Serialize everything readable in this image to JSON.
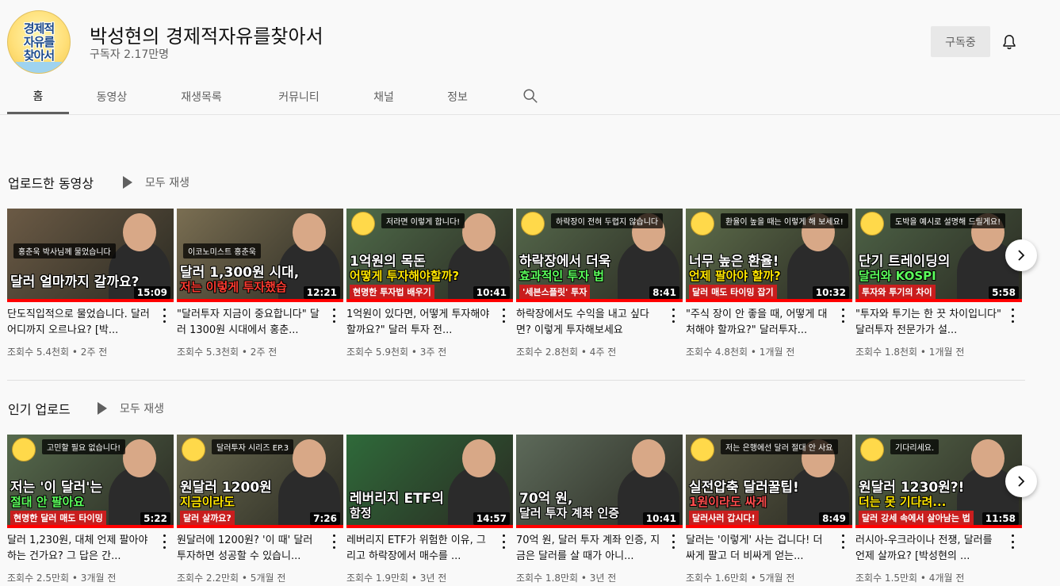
{
  "channel": {
    "avatar_lines": [
      "경제적",
      "자유를",
      "찾아서"
    ],
    "name": "박성현의 경제적자유를찾아서",
    "subscribers": "구독자 2.17만명",
    "subscribed_label": "구독중"
  },
  "tabs": [
    {
      "label": "홈",
      "active": true
    },
    {
      "label": "동영상",
      "active": false
    },
    {
      "label": "재생목록",
      "active": false
    },
    {
      "label": "커뮤니티",
      "active": false
    },
    {
      "label": "채널",
      "active": false
    },
    {
      "label": "정보",
      "active": false
    }
  ],
  "shelves": [
    {
      "title": "업로드한 동영상",
      "play_all": "모두 재생",
      "videos": [
        {
          "title": "단도직입적으로 물었습니다. 달러 어디까지 오르나요? [박...",
          "meta": "조회수 5.4천회 • 2주 전",
          "duration": "15:09",
          "thumb": {
            "strip": "홍춘욱 박사님께 물었습니다",
            "line1": "달러 얼마까지 갈까요?",
            "line2": "",
            "line3": "",
            "accent": "#ffffff",
            "bg": "#6b5a45"
          }
        },
        {
          "title": "\"달러투자 지금이 중요합니다\" 달러 1300원 시대에서 홍춘...",
          "meta": "조회수 5.3천회 • 2주 전",
          "duration": "12:21",
          "thumb": {
            "strip": "이코노미스트 홍춘욱",
            "line1": "달러 1,300원 시대,",
            "line2": "저는 이렇게 투자했습",
            "line3": "",
            "accent": "#ff3b30",
            "bg": "#7a6e52"
          }
        },
        {
          "title": "1억원이 있다면, 어떻게 투자해야 할까요?\" 달러 투자 전...",
          "meta": "조회수 5.9천회 • 3주 전",
          "duration": "10:41",
          "thumb": {
            "strip": "저라면 이렇게 합니다!",
            "line1": "1억원의 목돈",
            "line2": "어떻게 투자해야할까?",
            "line3": "현명한 투자법 배우기",
            "accent": "#ffe600",
            "bg": "#4f6b4a"
          }
        },
        {
          "title": "하락장에서도 수익을 내고 싶다면? 이렇게 투자해보세요",
          "meta": "조회수 2.8천회 • 4주 전",
          "duration": "8:41",
          "thumb": {
            "strip": "하락장이 전혀 두렵지 않습니다",
            "line1": "하락장에서 더욱",
            "line2": "효과적인 투자 법",
            "line3": "'세븐스플릿' 투자",
            "accent": "#5cff5c",
            "bg": "#55684b"
          }
        },
        {
          "title": "\"주식 장이 안 좋을 때, 어떻게 대처해야 할까요?\" 달러투자...",
          "meta": "조회수 4.8천회 • 1개월 전",
          "duration": "10:32",
          "thumb": {
            "strip": "환율이 높을 때는 이렇게 해 보세요!",
            "line1": "너무 높은 환율!",
            "line2": "언제 팔아야 할까?",
            "line3": "달러 매도 타이밍 잡기",
            "accent": "#ffe600",
            "bg": "#5e6e4c"
          }
        },
        {
          "title": "\"투자와 투기는 한 끗 차이입니다\" 달러투자 전문가가 설...",
          "meta": "조회수 1.8천회 • 1개월 전",
          "duration": "5:58",
          "thumb": {
            "strip": "도박을 예시로 설명해 드릴게요!",
            "line1": "단기 트레이딩의",
            "line2": "달러와 KOSPI",
            "line3": "투자와 투기의 차이",
            "accent": "#5cff5c",
            "bg": "#4d6246"
          }
        }
      ]
    },
    {
      "title": "인기 업로드",
      "play_all": "모두 재생",
      "videos": [
        {
          "title": "달러 1,230원, 대체 언제 팔아야 하는 건가요? 그 답은 간...",
          "meta": "조회수 2.5만회 • 3개월 전",
          "duration": "5:22",
          "thumb": {
            "strip": "고민할 필요 없습니다!",
            "line1": "저는 '이 달러'는",
            "line2": "절대 안 팔아요",
            "line3": "현명한 달러 매도 타이밍",
            "accent": "#5cff5c",
            "bg": "#566a4d"
          }
        },
        {
          "title": "원달러에 1200원? '이 때' 달러 투자하면 성공할 수 있습니...",
          "meta": "조회수 2.2만회 • 5개월 전",
          "duration": "7:26",
          "thumb": {
            "strip": "달러투자 시리즈 EP.3",
            "line1": "원달러 1200원",
            "line2": "지금이라도",
            "line3": "달러 살까요?",
            "accent": "#ffe600",
            "bg": "#6a6a50"
          }
        },
        {
          "title": "레버리지 ETF가 위험한 이유, 그리고 하락장에서 매수를 ...",
          "meta": "조회수 1.9만회 • 3년 전",
          "duration": "14:57",
          "thumb": {
            "strip": "",
            "line1": "레버리지 ETF의",
            "line2": "함정",
            "line3": "",
            "accent": "#ffffff",
            "bg": "#2f6a3a"
          }
        },
        {
          "title": "70억 원, 달러 투자 계좌 인증, 지금은 달러를 살 때가 아니...",
          "meta": "조회수 1.8만회 • 3년 전",
          "duration": "10:41",
          "thumb": {
            "strip": "",
            "line1": "70억 원,",
            "line2": "달러 투자 계좌 인증",
            "line3": "",
            "accent": "#ffffff",
            "bg": "#5d6a5a"
          }
        },
        {
          "title": "달러는 '이렇게' 사는 겁니다! 더 싸게 팔고 더 비싸게 얻는...",
          "meta": "조회수 1.6만회 • 5개월 전",
          "duration": "8:49",
          "thumb": {
            "strip": "저는 은행에선 달러 절대 안 사요",
            "line1": "실전압축 달러꿀팁!",
            "line2": "1원이라도 싸게",
            "line3": "달러사러 갑시다!",
            "accent": "#ff4d4d",
            "bg": "#5f5f48"
          }
        },
        {
          "title": "러시아-우크라이나 전쟁, 달러를 언제 살까요? [박성현의 ...",
          "meta": "조회수 1.5만회 • 4개월 전",
          "duration": "11:58",
          "thumb": {
            "strip": "기다리세요.",
            "line1": "원달러 1230원?!",
            "line2": "더는 못 기다려...",
            "line3": "달러 강세 속에서 살아남는 법",
            "accent": "#ffe600",
            "bg": "#56664a"
          }
        }
      ]
    }
  ],
  "icons": {
    "bell": "bell-icon",
    "search": "search-icon",
    "next": "chevron-right-icon",
    "play": "play-icon"
  }
}
